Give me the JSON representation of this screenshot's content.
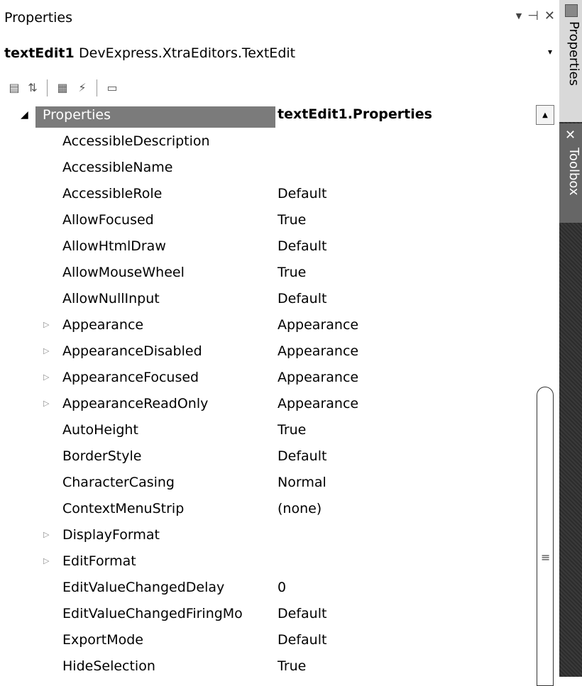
{
  "window": {
    "title": "Properties",
    "controls": {
      "dropdown": "▼",
      "pin": "⊣",
      "close": "✕"
    }
  },
  "object_selector": {
    "name": "textEdit1",
    "type": "DevExpress.XtraEditors.TextEdit",
    "dropdown_icon": "▾"
  },
  "toolbar": {
    "categorized_icon": "▤",
    "alphabetical_icon": "⇅",
    "properties_icon": "▦",
    "events_icon": "⚡",
    "property_pages_icon": "▭"
  },
  "grid": {
    "category": {
      "name": "Properties",
      "value": "textEdit1.Properties",
      "expanded_icon": "◢"
    },
    "rows": [
      {
        "name": "AccessibleDescription",
        "value": "",
        "expandable": false
      },
      {
        "name": "AccessibleName",
        "value": "",
        "expandable": false
      },
      {
        "name": "AccessibleRole",
        "value": "Default",
        "expandable": false
      },
      {
        "name": "AllowFocused",
        "value": "True",
        "expandable": false
      },
      {
        "name": "AllowHtmlDraw",
        "value": "Default",
        "expandable": false
      },
      {
        "name": "AllowMouseWheel",
        "value": "True",
        "expandable": false
      },
      {
        "name": "AllowNullInput",
        "value": "Default",
        "expandable": false
      },
      {
        "name": "Appearance",
        "value": "Appearance",
        "expandable": true
      },
      {
        "name": "AppearanceDisabled",
        "value": "Appearance",
        "expandable": true
      },
      {
        "name": "AppearanceFocused",
        "value": "Appearance",
        "expandable": true
      },
      {
        "name": "AppearanceReadOnly",
        "value": "Appearance",
        "expandable": true
      },
      {
        "name": "AutoHeight",
        "value": "True",
        "expandable": false
      },
      {
        "name": "BorderStyle",
        "value": "Default",
        "expandable": false
      },
      {
        "name": "CharacterCasing",
        "value": "Normal",
        "expandable": false
      },
      {
        "name": "ContextMenuStrip",
        "value": "(none)",
        "expandable": false
      },
      {
        "name": "DisplayFormat",
        "value": "",
        "expandable": true
      },
      {
        "name": "EditFormat",
        "value": "",
        "expandable": true
      },
      {
        "name": "EditValueChangedDelay",
        "value": "0",
        "expandable": false
      },
      {
        "name": "EditValueChangedFiringMo",
        "value": "Default",
        "expandable": false
      },
      {
        "name": "ExportMode",
        "value": "Default",
        "expandable": false
      },
      {
        "name": "HideSelection",
        "value": "True",
        "expandable": false
      }
    ],
    "expand_icon": "▷"
  },
  "scrollbar": {
    "up_icon": "▲",
    "grip_icon": "≡"
  },
  "dock": {
    "properties_tab": "Properties",
    "toolbox_tab": "Toolbox",
    "toolbox_icon": "✕"
  }
}
